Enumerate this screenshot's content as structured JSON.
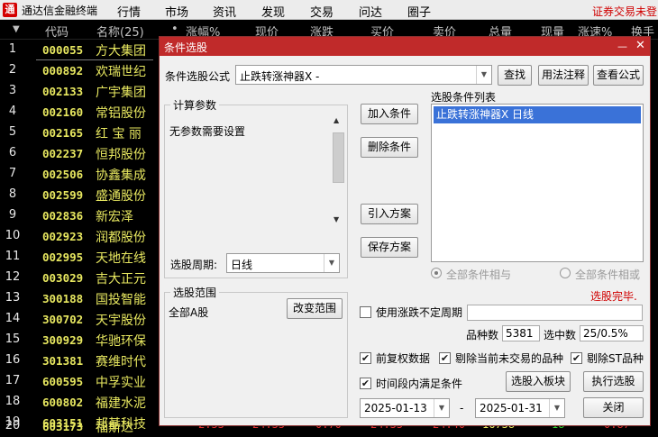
{
  "app": {
    "logo_text": "通",
    "title": "通达信金融终端"
  },
  "menu": [
    "行情",
    "市场",
    "资讯",
    "发现",
    "交易",
    "问达",
    "圈子"
  ],
  "notice": "证券交易未登",
  "quote_header": {
    "sort_icon": "▼",
    "code": "代码",
    "name": "名称(25)",
    "dot": "•",
    "cols": [
      "涨幅%",
      "现价",
      "涨跌",
      "买价",
      "卖价",
      "总量",
      "现量",
      "涨速%",
      "换手"
    ]
  },
  "rows": [
    {
      "n": "1",
      "code": "000055",
      "name": "方大集团"
    },
    {
      "n": "2",
      "code": "000892",
      "name": "欢瑞世纪"
    },
    {
      "n": "3",
      "code": "002133",
      "name": "广宇集团"
    },
    {
      "n": "4",
      "code": "002160",
      "name": "常铝股份"
    },
    {
      "n": "5",
      "code": "002165",
      "name": "红 宝 丽"
    },
    {
      "n": "6",
      "code": "002237",
      "name": "恒邦股份"
    },
    {
      "n": "7",
      "code": "002506",
      "name": "协鑫集成"
    },
    {
      "n": "8",
      "code": "002599",
      "name": "盛通股份"
    },
    {
      "n": "9",
      "code": "002836",
      "name": "新宏泽"
    },
    {
      "n": "10",
      "code": "002923",
      "name": "润都股份"
    },
    {
      "n": "11",
      "code": "002995",
      "name": "天地在线"
    },
    {
      "n": "12",
      "code": "003029",
      "name": "吉大正元"
    },
    {
      "n": "13",
      "code": "300188",
      "name": "国投智能"
    },
    {
      "n": "14",
      "code": "300702",
      "name": "天宇股份"
    },
    {
      "n": "15",
      "code": "300929",
      "name": "华驰环保"
    },
    {
      "n": "16",
      "code": "301381",
      "name": "赛维时代"
    },
    {
      "n": "17",
      "code": "600595",
      "name": "中孚实业"
    },
    {
      "n": "18",
      "code": "600802",
      "name": "福建水泥"
    },
    {
      "n": "19",
      "code": "603151",
      "name": "邦基科技"
    },
    {
      "n": "20",
      "code": "603173",
      "name": "福斯达"
    }
  ],
  "row20_values": [
    "2.53",
    "24.35",
    "0.70",
    "24.35",
    "24.40",
    "16738",
    "18",
    "0.87"
  ],
  "dialog": {
    "title": "条件选股",
    "min_icon": "—",
    "close_icon": "✕",
    "formula_label": "条件选股公式",
    "formula_value": "止跌转涨神器X -",
    "find_btn": "查找",
    "usage_btn": "用法注释",
    "view_btn": "查看公式",
    "params_group": "计算参数",
    "params_text": "无参数需要设置",
    "period_label": "选股周期:",
    "period_value": "日线",
    "range_group": "选股范围",
    "range_value": "全部A股",
    "change_range_btn": "改变范围",
    "add_btn": "加入条件",
    "del_btn": "删除条件",
    "import_btn": "引入方案",
    "save_btn": "保存方案",
    "list_label": "选股条件列表",
    "list_items": [
      "止跌转涨神器X  日线"
    ],
    "radio_and": "全部条件相与",
    "radio_or": "全部条件相或",
    "status": "选股完毕.",
    "status_color": "#d00000",
    "use_period_label": "使用涨跌不定周期",
    "count_label": "品种数",
    "count_value": "5381",
    "selected_label": "选中数",
    "selected_value": "25/0.5%",
    "adj_label": "前复权数据",
    "exclude_untraded_label": "剔除当前未交易的品种",
    "exclude_st_label": "剔除ST品种",
    "timespan_label": "时间段内满足条件",
    "to_board_btn": "选股入板块",
    "run_btn": "执行选股",
    "date_from": "2025-01-13",
    "date_sep": "-",
    "date_to": "2025-01-31",
    "close_btn": "关闭",
    "check_mark": "✔",
    "combo_arrow": "▼",
    "scroll_up": "▲",
    "scroll_down": "▼"
  },
  "colors": {
    "accent": "#c02a2a",
    "code_text": "#e8e860",
    "row_num": "#e8e8e8"
  }
}
